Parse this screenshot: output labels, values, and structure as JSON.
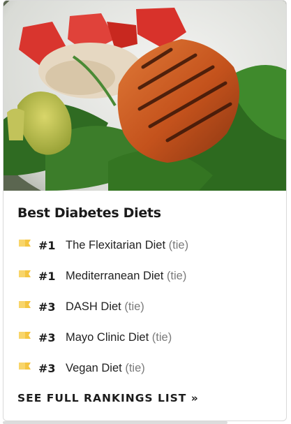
{
  "card": {
    "image_alt": "grilled salmon with spinach, avocado, tomatoes and rice",
    "heading": "Best Diabetes Diets",
    "rankings": [
      {
        "rank": "#1",
        "name": "The Flexitarian Diet",
        "tie": "(tie)"
      },
      {
        "rank": "#1",
        "name": "Mediterranean Diet",
        "tie": "(tie)"
      },
      {
        "rank": "#3",
        "name": "DASH Diet",
        "tie": "(tie)"
      },
      {
        "rank": "#3",
        "name": "Mayo Clinic Diet",
        "tie": "(tie)"
      },
      {
        "rank": "#3",
        "name": "Vegan Diet",
        "tie": "(tie)"
      }
    ],
    "see_all_label": "SEE FULL RANKINGS LIST »",
    "ribbon_icon": "gold-ribbon-icon",
    "colors": {
      "ribbon": "#f4c542",
      "heading": "#1b1b1b",
      "tie": "#7a7a7a"
    }
  }
}
